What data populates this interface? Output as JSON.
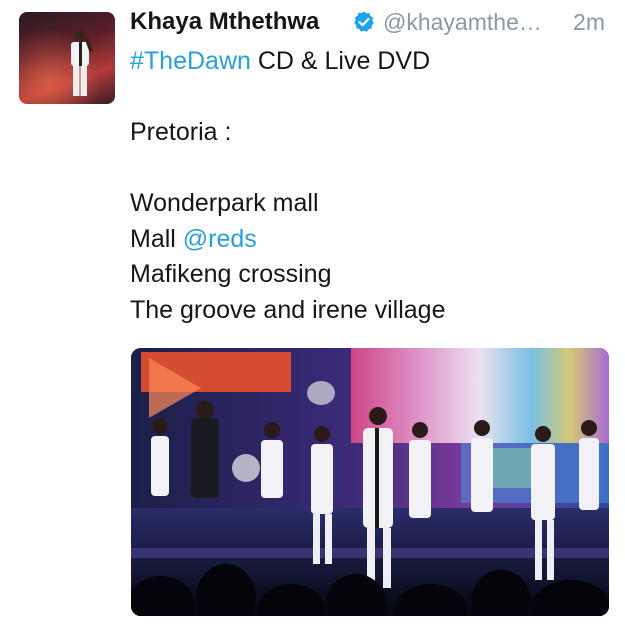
{
  "author": {
    "name": "Khaya Mthethwa",
    "handle": "@khayamthe…",
    "timestamp": "2m",
    "verified": true
  },
  "tweet": {
    "line1": {
      "hashtag": "#TheDawn",
      "rest": " CD & Live DVD"
    },
    "line2": "Pretoria :",
    "line3": "Wonderpark mall",
    "line4": {
      "prefix": "Mall ",
      "mention": "@reds"
    },
    "line5": "Mafikeng crossing",
    "line6": "The groove and irene village"
  },
  "colors": {
    "link": "#2b9fd9",
    "secondary_text": "#8899a6",
    "verified_badge": "#1da1f2"
  }
}
